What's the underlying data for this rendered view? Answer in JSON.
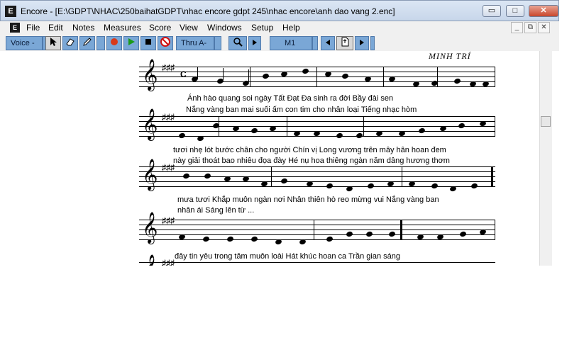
{
  "window": {
    "title": "Encore - [E:\\GDPT\\NHAC\\250baihatGDPT\\nhac encore gdpt 245\\nhac encore\\anh dao vang 2.enc]",
    "app_icon_letter": "E",
    "buttons": {
      "minimize": "▭",
      "maximize": "□",
      "close": "✕"
    }
  },
  "menubar": {
    "items": [
      "File",
      "Edit",
      "Notes",
      "Measures",
      "Score",
      "View",
      "Windows",
      "Setup",
      "Help"
    ],
    "mdi_buttons": [
      "_",
      "⧉",
      "✕"
    ]
  },
  "toolbar": {
    "voice_label": "Voice -",
    "thru_label": "Thru A-",
    "measure_label": "M1",
    "icons": [
      "arrow-pointer-icon",
      "eraser-icon",
      "pencil-icon",
      "record-icon",
      "play-icon",
      "stop-icon",
      "mute-icon",
      "magnifier-icon",
      "prev-icon",
      "page-icon",
      "next-icon"
    ]
  },
  "score": {
    "composer": "MINH TRÍ",
    "lyrics": [
      {
        "line": "Ánh  hào  quang    soi  ngày  Tất  Đạt  Đa  sinh       ra   đời  Bầy    đài  sen"
      },
      {
        "line": "Nắng  vàng    ban        mai  suối  ấm  con  tim  cho      nhân  loại   Tiếng  nhạc  hòm"
      },
      {
        "line": "tươi  nhẹ  lót  bước  chân  cho  người  Chín  vị      Long vương  trên  mây   hân  hoan  đem"
      },
      {
        "line": "này  giải  thoát  bao  nhiêu  đọa   đày    Hé    nụ      hoa  thiêng  ngàn  năm   dâng hương  thơm"
      },
      {
        "line": "mưa  tươi  Khắp muôn  ngàn    nơi    Nhân  thiên    hò    reo  mừng    vui   Nắng vàng   ban"
      },
      {
        "line": "nhân  ái  Sáng  lên   từ       ..."
      },
      {
        "line": "đây    tin    yêu   trong    tâm   muôn    loài    Hát   khúc   hoan     ca   Trần  gian  sáng"
      }
    ]
  }
}
